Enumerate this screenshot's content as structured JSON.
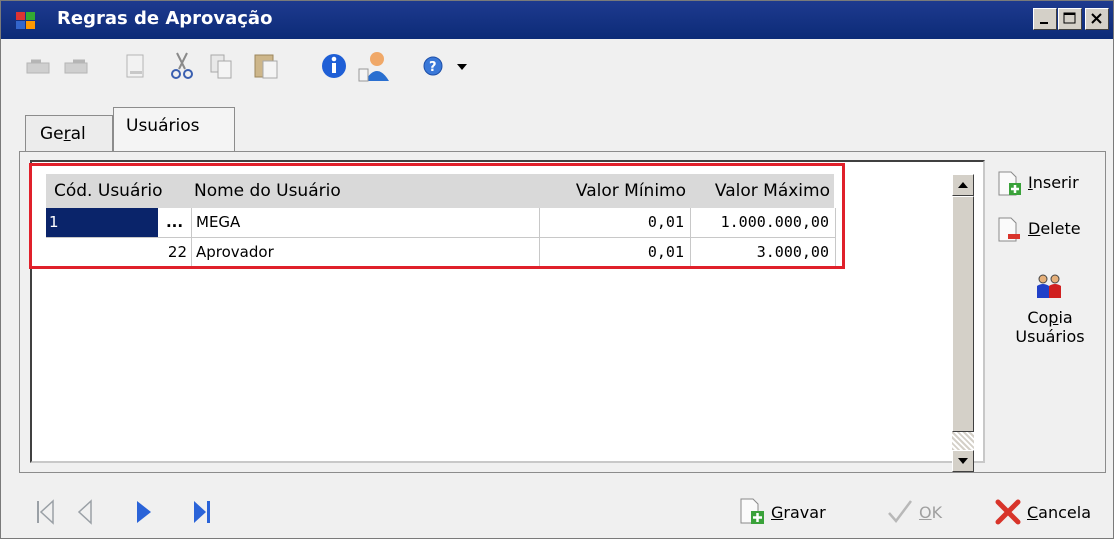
{
  "window": {
    "title": "Regras de Aprovação"
  },
  "toolbar": {
    "items": [
      "undo-icon",
      "redo-icon",
      "new-document-icon",
      "cut-icon",
      "copy-icon",
      "paste-icon",
      "info-icon",
      "user-icon",
      "help-icon",
      "dropdown-icon"
    ]
  },
  "tabs": [
    {
      "label": "Geral",
      "accel": "r",
      "active": false
    },
    {
      "label": "Usuários",
      "active": true
    }
  ],
  "grid": {
    "columns": [
      "Cód. Usuário",
      "Nome do Usuário",
      "Valor Mínimo",
      "Valor Máximo"
    ],
    "rows": [
      {
        "codigo": "1",
        "ellipsis": "...",
        "nome": "MEGA",
        "minimo": "0,01",
        "maximo": "1.000.000,00"
      },
      {
        "codigo": "22",
        "nome": "Aprovador",
        "minimo": "0,01",
        "maximo": "3.000,00"
      }
    ]
  },
  "side_buttons": {
    "inserir": {
      "accel": "I",
      "rest": "nserir"
    },
    "delete": {
      "accel": "D",
      "rest": "elete"
    },
    "copia": {
      "line1_pre": "Co",
      "line1_accel": "p",
      "line1_post": "ia",
      "line2": "Usuários"
    }
  },
  "bottom": {
    "gravar": {
      "accel": "G",
      "rest": "ravar"
    },
    "ok": {
      "accel": "O",
      "rest": "K"
    },
    "cancela": {
      "accel": "C",
      "rest": "ancela"
    }
  },
  "colors": {
    "titlebar": "#0c2b77",
    "selection": "#0a246a",
    "highlight": "#e0202a"
  }
}
